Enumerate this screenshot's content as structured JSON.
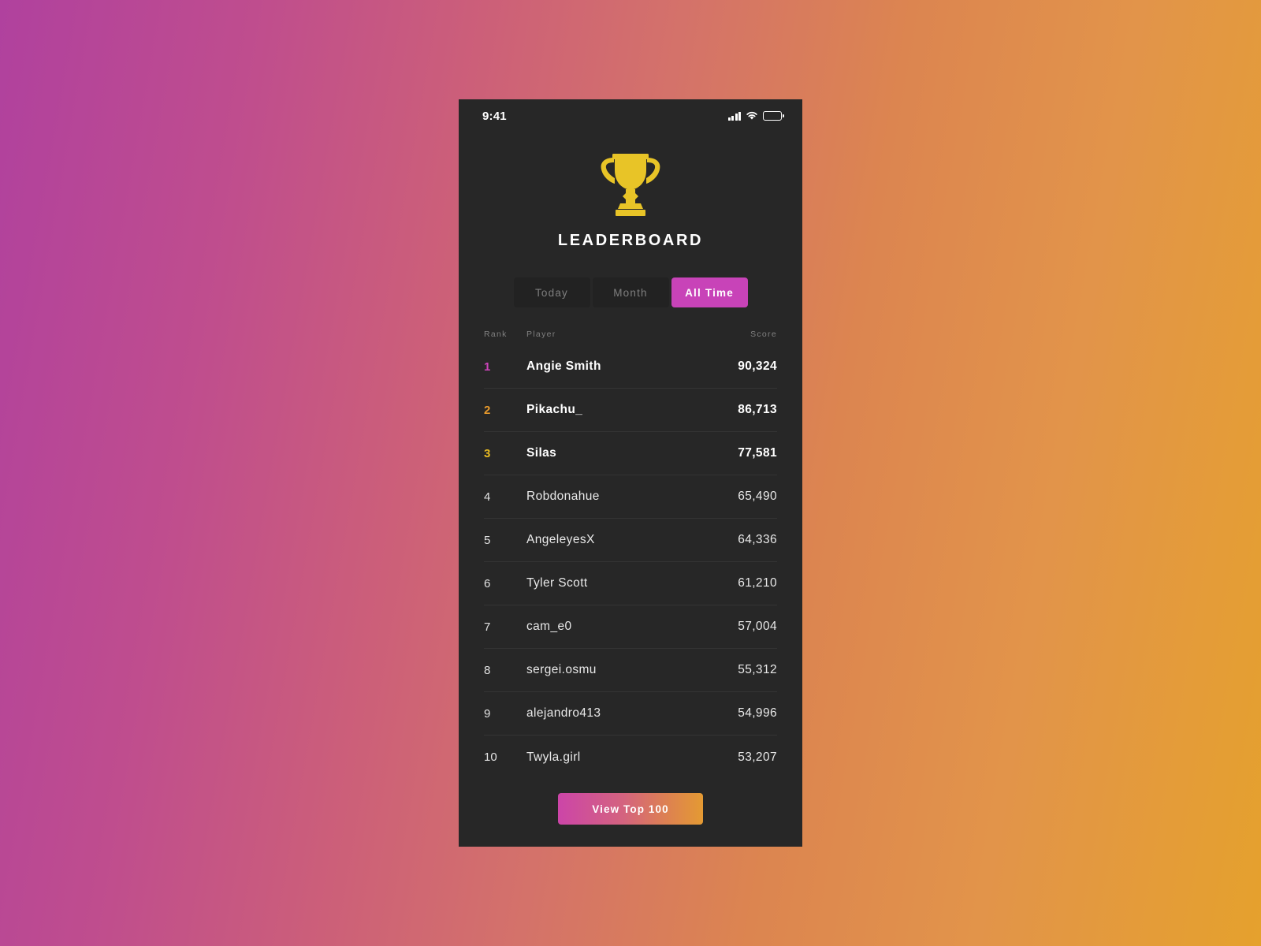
{
  "background": {
    "gradient_from": "#b0419e",
    "gradient_to": "#e5a12d"
  },
  "statusbar": {
    "time": "9:41",
    "signal_icon": "cellular-signal-icon",
    "wifi_icon": "wifi-icon",
    "battery_icon": "battery-icon"
  },
  "hero": {
    "trophy_icon": "trophy-icon",
    "trophy_color": "#e8c427",
    "title": "LEADERBOARD"
  },
  "tabs": {
    "items": [
      {
        "label": "Today",
        "active": false
      },
      {
        "label": "Month",
        "active": false
      },
      {
        "label": "All Time",
        "active": true
      }
    ],
    "active_color": "#c843b8",
    "inactive_color": "#222222"
  },
  "table": {
    "headers": {
      "rank": "Rank",
      "player": "Player",
      "score": "Score"
    },
    "rank_colors": {
      "1": "#cc44bb",
      "2": "#e89a2c",
      "3": "#e8bb22"
    },
    "rows": [
      {
        "rank": "1",
        "player": "Angie Smith",
        "score": "90,324"
      },
      {
        "rank": "2",
        "player": "Pikachu_",
        "score": "86,713"
      },
      {
        "rank": "3",
        "player": "Silas",
        "score": "77,581"
      },
      {
        "rank": "4",
        "player": "Robdonahue",
        "score": "65,490"
      },
      {
        "rank": "5",
        "player": "AngeleyesX",
        "score": "64,336"
      },
      {
        "rank": "6",
        "player": "Tyler Scott",
        "score": "61,210"
      },
      {
        "rank": "7",
        "player": "cam_e0",
        "score": "57,004"
      },
      {
        "rank": "8",
        "player": "sergei.osmu",
        "score": "55,312"
      },
      {
        "rank": "9",
        "player": "alejandro413",
        "score": "54,996"
      },
      {
        "rank": "10",
        "player": "Twyla.girl",
        "score": "53,207"
      }
    ]
  },
  "cta": {
    "label": "View Top 100",
    "gradient_from": "#cc45a8",
    "gradient_to": "#e49a33"
  }
}
